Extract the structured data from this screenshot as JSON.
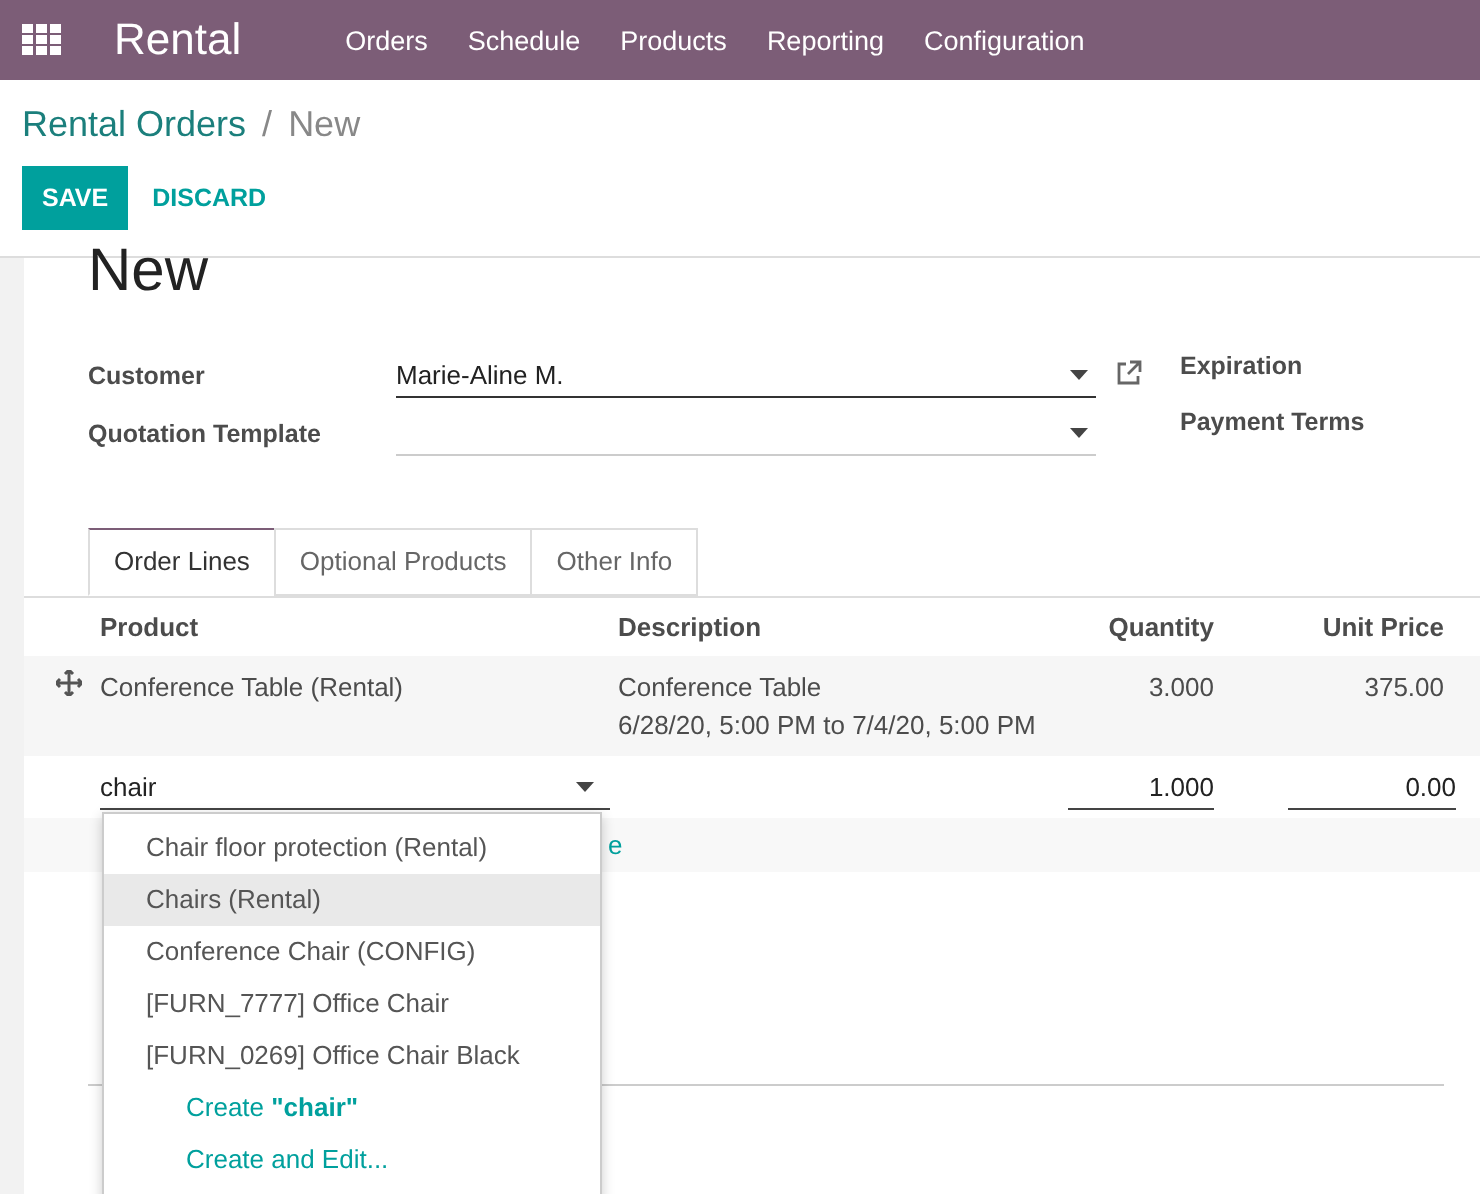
{
  "app": {
    "title": "Rental",
    "menu": [
      "Orders",
      "Schedule",
      "Products",
      "Reporting",
      "Configuration"
    ]
  },
  "breadcrumb": {
    "parent": "Rental Orders",
    "separator": "/",
    "current": "New"
  },
  "buttons": [
    {
      "label": "SAVE",
      "kind": "primary"
    },
    {
      "label": "DISCARD",
      "kind": "link"
    }
  ],
  "form": {
    "title": "New",
    "fields": [
      {
        "label": "Customer",
        "value": "Marie-Aline M.",
        "focused": true,
        "external_link": true
      },
      {
        "label": "Quotation Template",
        "focused": false
      }
    ],
    "side_labels": [
      "Expiration",
      "Payment Terms"
    ]
  },
  "tabs": [
    {
      "label": "Order Lines",
      "selected": true
    },
    {
      "label": "Optional Products",
      "selected": false
    },
    {
      "label": "Other Info",
      "selected": false
    }
  ],
  "table": {
    "columns": [
      "Product",
      "Description",
      "Quantity",
      "Unit Price"
    ],
    "rows": [
      {
        "product": "Conference Table (Rental)",
        "description": [
          "Conference Table",
          "6/28/20, 5:00 PM to 7/4/20, 5:00 PM"
        ],
        "quantity": "3.000",
        "unit_price": "375.00"
      }
    ],
    "edit_row": {
      "product": "chair",
      "quantity": "1.000",
      "unit_price": "0.00"
    },
    "add_line_fragment": "e"
  },
  "autocomplete": [
    {
      "label": "Chair floor protection (Rental)",
      "kind": "option",
      "highlighted": false
    },
    {
      "label": "Chairs (Rental)",
      "kind": "option",
      "highlighted": true
    },
    {
      "label": "Conference Chair (CONFIG)",
      "kind": "option",
      "highlighted": false
    },
    {
      "label": "[FURN_7777] Office Chair",
      "kind": "option",
      "highlighted": false
    },
    {
      "label": "[FURN_0269] Office Chair Black",
      "kind": "option",
      "highlighted": false
    },
    {
      "label": "Create **\"chair\"**",
      "kind": "create",
      "highlighted": false
    },
    {
      "label": "Create and Edit...",
      "kind": "create",
      "highlighted": false
    }
  ]
}
